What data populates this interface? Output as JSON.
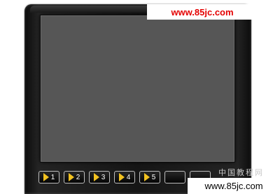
{
  "player": {
    "buttons": [
      {
        "label": "1"
      },
      {
        "label": "2"
      },
      {
        "label": "3"
      },
      {
        "label": "4"
      },
      {
        "label": "5"
      }
    ],
    "icon": "play-icon",
    "accent_color": "#f2c220"
  },
  "watermark": {
    "top_text": "www.85jc.com",
    "bottom_text": "www.85jc.com",
    "faint_text": "中国教程网"
  }
}
